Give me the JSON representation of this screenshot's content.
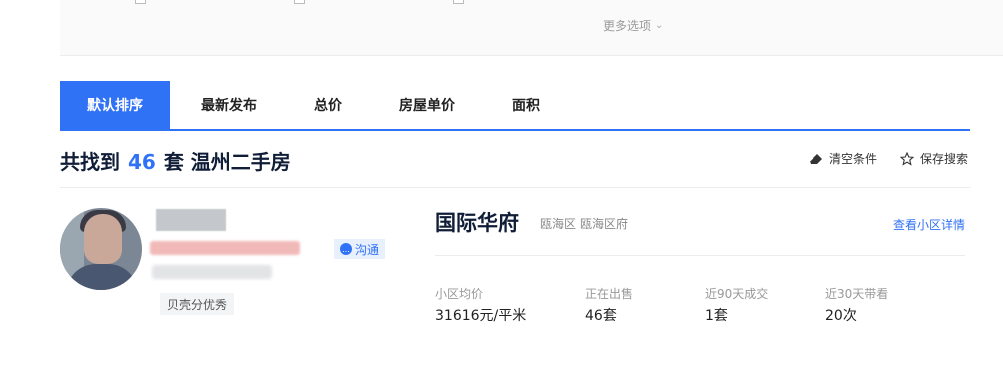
{
  "filters": {
    "more_options_label": "更多选项"
  },
  "sort_tabs": [
    {
      "label": "默认排序",
      "active": true
    },
    {
      "label": "最新发布",
      "active": false
    },
    {
      "label": "总价",
      "active": false
    },
    {
      "label": "房屋单价",
      "active": false
    },
    {
      "label": "面积",
      "active": false
    }
  ],
  "results": {
    "prefix": "共找到",
    "count": "46",
    "suffix": "套 温州二手房"
  },
  "actions": {
    "clear_label": "清空条件",
    "save_label": "保存搜索"
  },
  "agent": {
    "chat_label": "沟通",
    "tag": "贝壳分优秀"
  },
  "community": {
    "name": "国际华府",
    "district": "瓯海区",
    "area": "瓯海区府",
    "detail_link": "查看小区详情",
    "stats": [
      {
        "label": "小区均价",
        "value": "31616元/平米"
      },
      {
        "label": "正在出售",
        "value": "46套"
      },
      {
        "label": "近90天成交",
        "value": "1套"
      },
      {
        "label": "近30天带看",
        "value": "20次"
      }
    ]
  },
  "colors": {
    "accent": "#3072f6",
    "title": "#101d37"
  }
}
